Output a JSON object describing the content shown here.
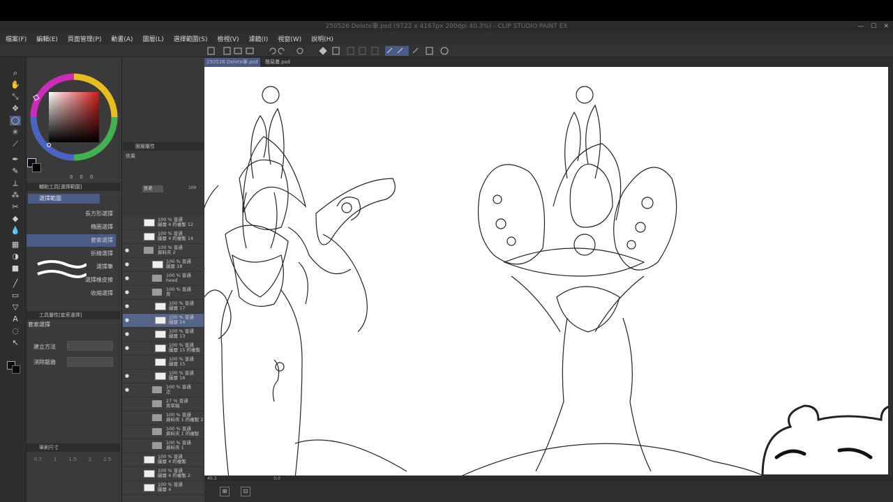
{
  "title": {
    "text": "250526 Delete筆.psd (9722 x 4167px 200dpi 40.3%)  - CLIP STUDIO PAINT EX"
  },
  "menu": [
    "檔案(F)",
    "編輯(E)",
    "頁面管理(P)",
    "動畫(A)",
    "圖層(L)",
    "選擇範圍(S)",
    "檢視(V)",
    "濾鏡(I)",
    "視窗(W)",
    "說明(H)"
  ],
  "doc_tabs": [
    "250526 Delete筆.psd",
    "簡易畫.psd"
  ],
  "sub_tool_panel": {
    "title": "輔助工具[選擇範圍]",
    "group": "選擇範圍"
  },
  "sub_tools": [
    "長方形選擇",
    "橢圓選擇",
    "套索選擇",
    "折線選擇",
    "選擇筆",
    "選擇橡皮擦",
    "收縮選擇"
  ],
  "tool_property": {
    "title": "工具屬性[套索選擇]",
    "tool_name": "套索選擇",
    "create_method": "建立方法",
    "antialias": "消除鋸齒"
  },
  "brush_size_panel": {
    "title": "筆刷尺寸",
    "sizes": [
      "0.7",
      "1",
      "1.5",
      "2",
      "2.5"
    ]
  },
  "color_values": {
    "a": "0",
    "b": "0",
    "c": "0"
  },
  "layer_panel": {
    "title": "圖層屬性",
    "effect": "效果",
    "blend": "普通",
    "opacity": "100"
  },
  "layers": [
    {
      "line1": "100 % 普通",
      "line2": "圖層 4 的複製 12",
      "type": "layer",
      "eye": false,
      "indent": 0,
      "selected": false
    },
    {
      "line1": "100 % 普通",
      "line2": "圖層 4 的複製 14",
      "type": "layer",
      "eye": false,
      "indent": 0,
      "selected": false
    },
    {
      "line1": "100 % 普通",
      "line2": "資料夾 2",
      "type": "folder",
      "eye": true,
      "indent": 0,
      "selected": false
    },
    {
      "line1": "100 % 普通",
      "line2": "圖層 18",
      "type": "layer",
      "eye": true,
      "indent": 1,
      "selected": false
    },
    {
      "line1": "100 % 普通",
      "line2": "head",
      "type": "folder",
      "eye": true,
      "indent": 1,
      "selected": false
    },
    {
      "line1": "100 % 普通",
      "line2": "背",
      "type": "folder",
      "eye": true,
      "indent": 1,
      "selected": false
    },
    {
      "line1": "100 % 普通",
      "line2": "圖層 17",
      "type": "layer",
      "eye": true,
      "indent": 2,
      "selected": false
    },
    {
      "line1": "100 % 普通",
      "line2": "圖層 14",
      "type": "layer",
      "eye": true,
      "indent": 2,
      "selected": true
    },
    {
      "line1": "100 % 普通",
      "line2": "圖層 13",
      "type": "layer",
      "eye": true,
      "indent": 2,
      "selected": false
    },
    {
      "line1": "100 % 普通",
      "line2": "圖層 15 的複製",
      "type": "layer",
      "eye": true,
      "indent": 2,
      "selected": false
    },
    {
      "line1": "100 % 普通",
      "line2": "圖層 15",
      "type": "layer",
      "eye": false,
      "indent": 2,
      "selected": false
    },
    {
      "line1": "100 % 普通",
      "line2": "圖層 16",
      "type": "layer",
      "eye": true,
      "indent": 2,
      "selected": false
    },
    {
      "line1": "100 % 普通",
      "line2": "正",
      "type": "folder",
      "eye": true,
      "indent": 1,
      "selected": false
    },
    {
      "line1": "27 % 普通",
      "line2": "背草稿",
      "type": "folder",
      "eye": false,
      "indent": 1,
      "selected": false
    },
    {
      "line1": "100 % 普通",
      "line2": "資料夾 1 的複製 2",
      "type": "folder",
      "eye": false,
      "indent": 1,
      "selected": false
    },
    {
      "line1": "100 % 普通",
      "line2": "資料夾 1 的複製",
      "type": "folder",
      "eye": false,
      "indent": 1,
      "selected": false
    },
    {
      "line1": "100 % 普通",
      "line2": "資料夾 1",
      "type": "folder",
      "eye": false,
      "indent": 1,
      "selected": false
    },
    {
      "line1": "100 % 普通",
      "line2": "圖層 4 的複製",
      "type": "layer",
      "eye": false,
      "indent": 0,
      "selected": false
    },
    {
      "line1": "100 % 普通",
      "line2": "圖層 4 的複製 2",
      "type": "layer",
      "eye": false,
      "indent": 0,
      "selected": false
    },
    {
      "line1": "100 % 普通",
      "line2": "圖層 4",
      "type": "layer",
      "eye": false,
      "indent": 0,
      "selected": false
    }
  ],
  "status": {
    "zoom": "40.3",
    "angle": "0.0"
  },
  "colors": {
    "accent": "#56648a",
    "canvas": "#ffffff",
    "panel": "#3a3a3a"
  }
}
